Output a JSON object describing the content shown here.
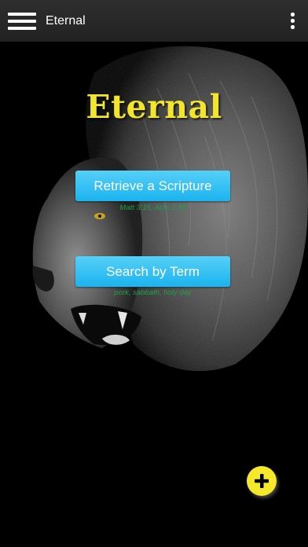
{
  "toolbar": {
    "title": "Eternal",
    "menu_icon": "hamburger-menu-icon",
    "overflow_icon": "more-vertical-icon"
  },
  "main": {
    "logo_text": "Eternal",
    "retrieve_button_label": "Retrieve a Scripture",
    "retrieve_hint": "Matt 3:16, Acts 2:38",
    "search_button_label": "Search by Term",
    "search_hint": "pork, sabbath, holy day"
  },
  "fab": {
    "icon": "plus-icon"
  },
  "colors": {
    "background": "#000000",
    "toolbar": "#2a2a2a",
    "accent_yellow": "#f5e82a",
    "button_blue": "#29b6f6",
    "hint_green": "#1ea04a"
  }
}
